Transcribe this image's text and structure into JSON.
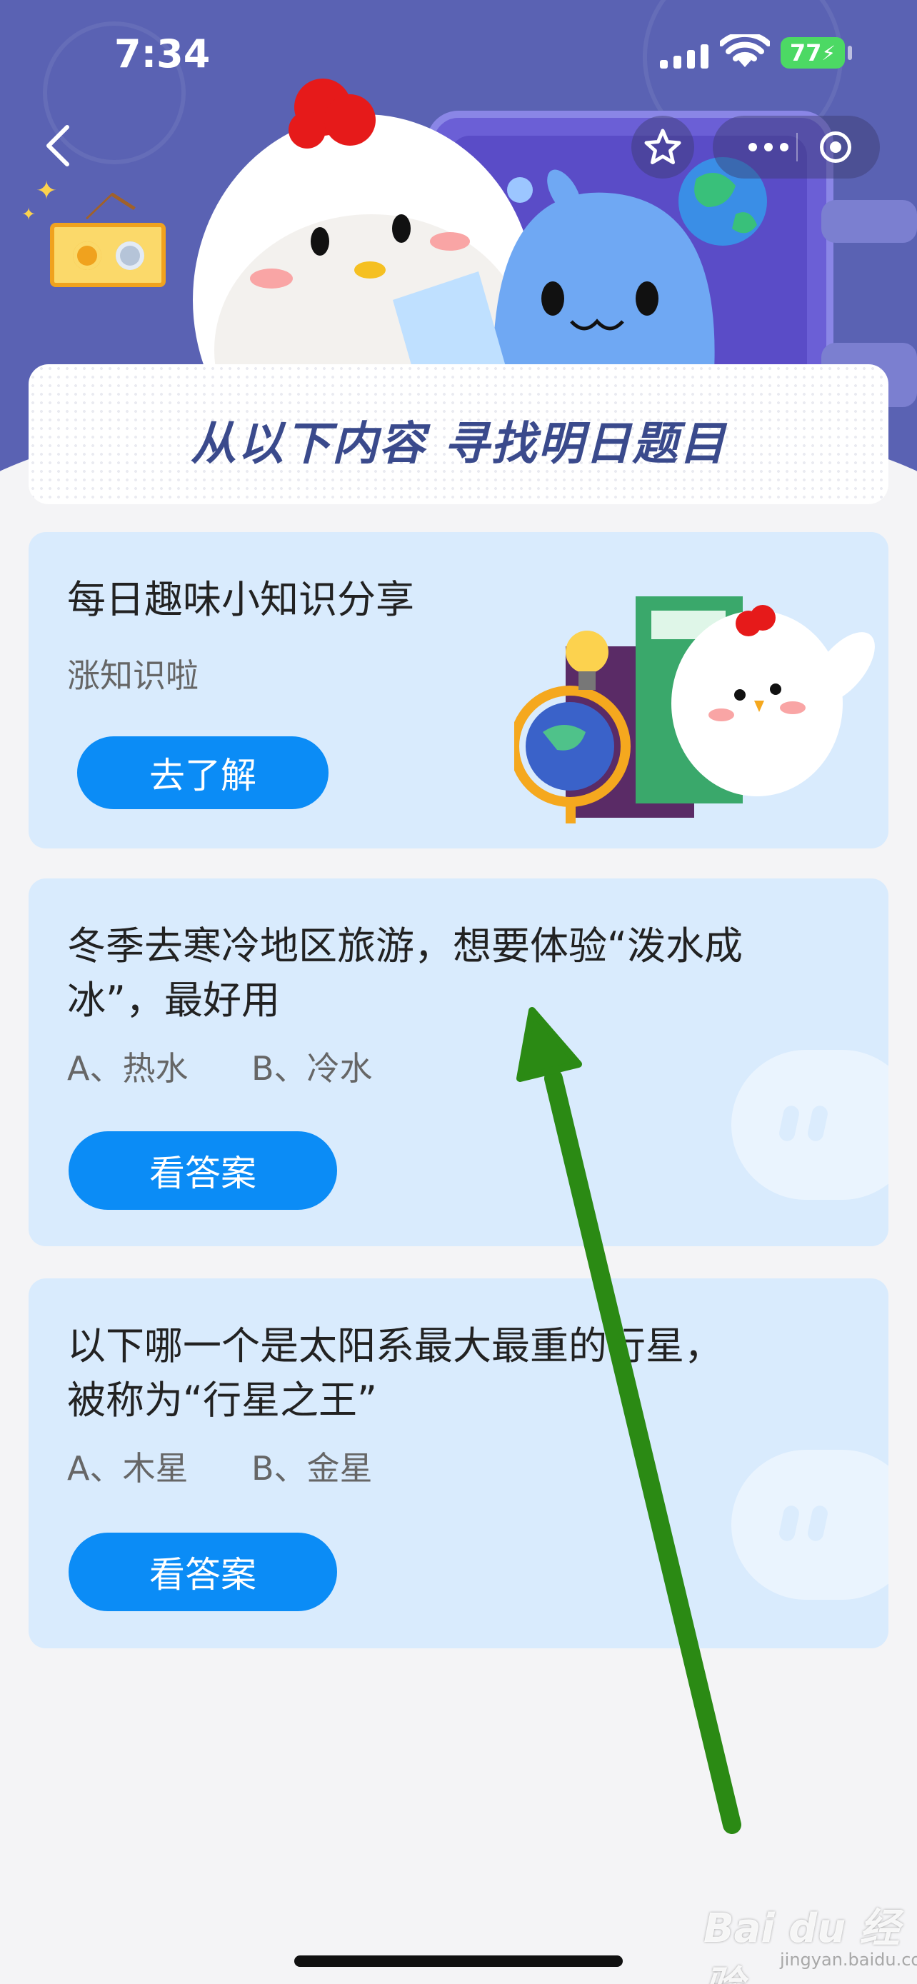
{
  "status_bar": {
    "time": "7:34",
    "battery": "77"
  },
  "header": {
    "banner_text": "从以下内容  寻找明日题目"
  },
  "cards": [
    {
      "title": "每日趣味小知识分享",
      "subtitle": "涨知识啦",
      "button": "去了解"
    },
    {
      "title_line1": "冬季去寒冷地区旅游，想要体验“泼水成",
      "title_line2": "冰”，最好用",
      "option_a": "A、热水",
      "option_b": "B、冷水",
      "button": "看答案"
    },
    {
      "title_line1": "以下哪一个是太阳系最大最重的行星，",
      "title_line2": "被称为“行星之王”",
      "option_a": "A、木星",
      "option_b": "B、金星",
      "button": "看答案"
    }
  ],
  "watermark": {
    "text": "Bai du 经验",
    "sub": "jingyan.baidu.com"
  },
  "colors": {
    "header_bg": "#5a62b3",
    "card_bg": "#d9ebfd",
    "button": "#0b8cf6",
    "annotation_arrow": "#2b8a14"
  }
}
